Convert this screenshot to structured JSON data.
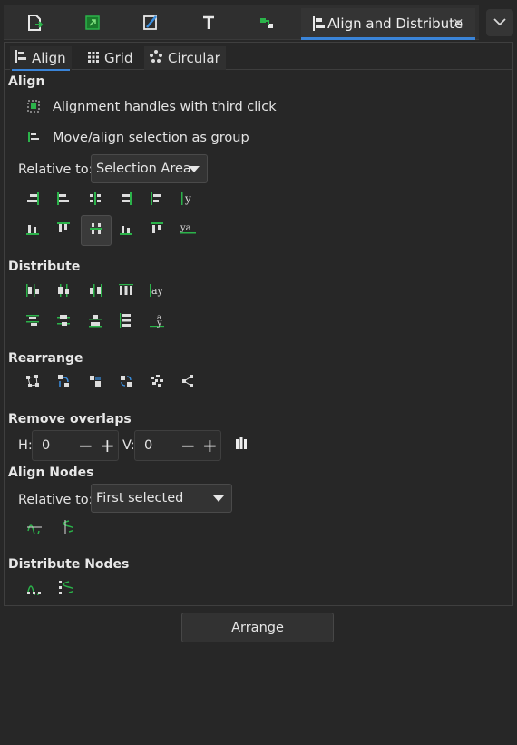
{
  "dock": {
    "icons": [
      "document-properties-icon",
      "export-image-icon",
      "fill-stroke-icon",
      "text-font-icon",
      "xml-editor-icon"
    ],
    "active_tab": {
      "label": "Align and Distribute",
      "close": "×",
      "icon": "align-distribute-icon"
    },
    "menu_icon": "chevron-down-icon"
  },
  "subtabs": [
    {
      "label": "Align",
      "icon": "align-icon"
    },
    {
      "label": "Grid",
      "icon": "grid-icon"
    },
    {
      "label": "Circular",
      "icon": "circular-icon"
    }
  ],
  "align": {
    "title": "Align",
    "handles_label": "Alignment handles with third click",
    "group_label": "Move/align selection as group",
    "relative_label": "Relative to:",
    "relative_value": "Selection Area"
  },
  "distribute": {
    "title": "Distribute"
  },
  "rearrange": {
    "title": "Rearrange"
  },
  "remove_overlaps": {
    "title": "Remove overlaps",
    "h_label": "H:",
    "h_value": "0",
    "v_label": "V:",
    "v_value": "0",
    "minus": "−",
    "plus": "+"
  },
  "align_nodes": {
    "title": "Align Nodes",
    "relative_label": "Relative to:",
    "relative_value": "First selected"
  },
  "distribute_nodes": {
    "title": "Distribute Nodes"
  },
  "arrange_label": "Arrange",
  "colors": {
    "accent": "#3a84d8",
    "icon_green": "#1fa33a",
    "icon_blue": "#3a8fe0"
  }
}
